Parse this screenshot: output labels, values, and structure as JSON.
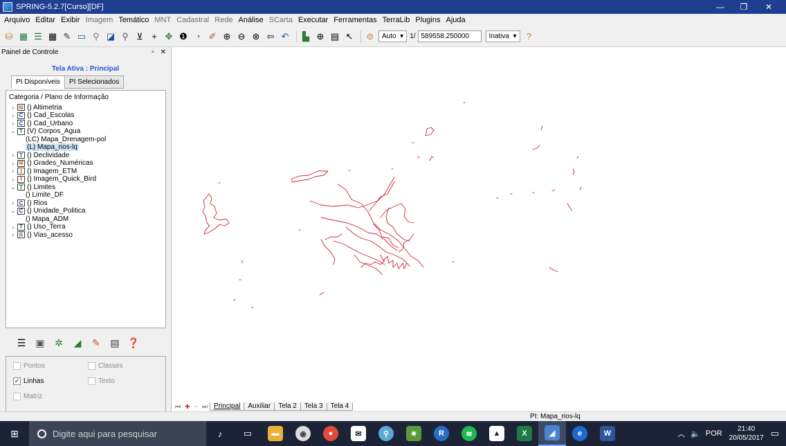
{
  "window": {
    "title": "SPRING-5.2.7[Curso][DF]"
  },
  "menu": [
    {
      "label": "Arquivo",
      "dim": false
    },
    {
      "label": "Editar",
      "dim": false
    },
    {
      "label": "Exibir",
      "dim": false
    },
    {
      "label": "Imagem",
      "dim": true
    },
    {
      "label": "Temático",
      "dim": false
    },
    {
      "label": "MNT",
      "dim": true
    },
    {
      "label": "Cadastral",
      "dim": true
    },
    {
      "label": "Rede",
      "dim": true
    },
    {
      "label": "Análise",
      "dim": false
    },
    {
      "label": "SCarta",
      "dim": true
    },
    {
      "label": "Executar",
      "dim": false
    },
    {
      "label": "Ferramentas",
      "dim": false
    },
    {
      "label": "TerraLib",
      "dim": false
    },
    {
      "label": "Plugins",
      "dim": false
    },
    {
      "label": "Ajuda",
      "dim": false
    }
  ],
  "toolbar": {
    "scale_mode": "Auto",
    "scale_prefix": "1/",
    "scale_value": "589558.250000",
    "state": "Inativa"
  },
  "panel": {
    "title": "Painel de Controle",
    "controls": "▫ ✕",
    "active_screen": "Tela Ativa : Principal",
    "tabs": [
      "PI Disponíveis",
      "PI Selecionados"
    ],
    "tree_header": "Categoria / Plano de Informação",
    "tree": [
      {
        "type": "cat",
        "caret": ">",
        "badge": "M",
        "badge_color": "#a8741a",
        "label": "() Altimetria"
      },
      {
        "type": "cat",
        "caret": ">",
        "badge": "C",
        "badge_color": "#1b3fa6",
        "label": "() Cad_Escolas"
      },
      {
        "type": "cat",
        "caret": ">",
        "badge": "C",
        "badge_color": "#1b3fa6",
        "label": "() Cad_Urbano"
      },
      {
        "type": "cat",
        "caret": "v",
        "badge": "T",
        "badge_color": "#15803d",
        "label": "(V) Corpos_Agua"
      },
      {
        "type": "pi",
        "label": "(LC) Mapa_Drenagem-pol",
        "selected": false
      },
      {
        "type": "pi",
        "label": "(L) Mapa_rios-lq",
        "selected": true
      },
      {
        "type": "cat",
        "caret": ">",
        "badge": "T",
        "badge_color": "#15803d",
        "label": "() Declividade"
      },
      {
        "type": "cat",
        "caret": ">",
        "badge": "M",
        "badge_color": "#a8741a",
        "label": "() Grades_Numéricas"
      },
      {
        "type": "cat",
        "caret": ">",
        "badge": "I",
        "badge_color": "#c2410c",
        "label": "() Imagem_ETM"
      },
      {
        "type": "cat",
        "caret": ">",
        "badge": "I",
        "badge_color": "#c2410c",
        "label": "() Imagem_Quick_Bird"
      },
      {
        "type": "cat",
        "caret": "v",
        "badge": "T",
        "badge_color": "#15803d",
        "label": "() Limites"
      },
      {
        "type": "pi",
        "label": "() Limite_DF",
        "selected": false
      },
      {
        "type": "cat",
        "caret": ">",
        "badge": "C",
        "badge_color": "#1b3fa6",
        "label": "() Rios"
      },
      {
        "type": "cat",
        "caret": "v",
        "badge": "C",
        "badge_color": "#1b3fa6",
        "label": "() Unidade_Politica"
      },
      {
        "type": "pi",
        "label": "() Mapa_ADM",
        "selected": false
      },
      {
        "type": "cat",
        "caret": ">",
        "badge": "T",
        "badge_color": "#15803d",
        "label": "() Uso_Terra"
      },
      {
        "type": "cat",
        "caret": ">",
        "badge": "R",
        "badge_color": "#6b7280",
        "label": "() Vias_acesso"
      }
    ],
    "checkboxes": {
      "pontos": {
        "label": "Pontos",
        "checked": false,
        "enabled": false
      },
      "classes": {
        "label": "Classes",
        "checked": false,
        "enabled": false
      },
      "linhas": {
        "label": "Linhas",
        "checked": true,
        "enabled": true
      },
      "texto": {
        "label": "Texto",
        "checked": false,
        "enabled": false
      },
      "matriz": {
        "label": "Matriz",
        "checked": false,
        "enabled": false
      }
    }
  },
  "map": {
    "line_color": "#d1253a"
  },
  "bottom_tabs": [
    "Principal",
    "Auxiliar",
    "Tela 2",
    "Tela 3",
    "Tela 4"
  ],
  "status": {
    "pi": "PI: Mapa_rios-lq"
  },
  "taskbar": {
    "search_placeholder": "Digite aqui para pesquisar",
    "lang": "POR",
    "time": "21:40",
    "date": "20/05/2017"
  }
}
